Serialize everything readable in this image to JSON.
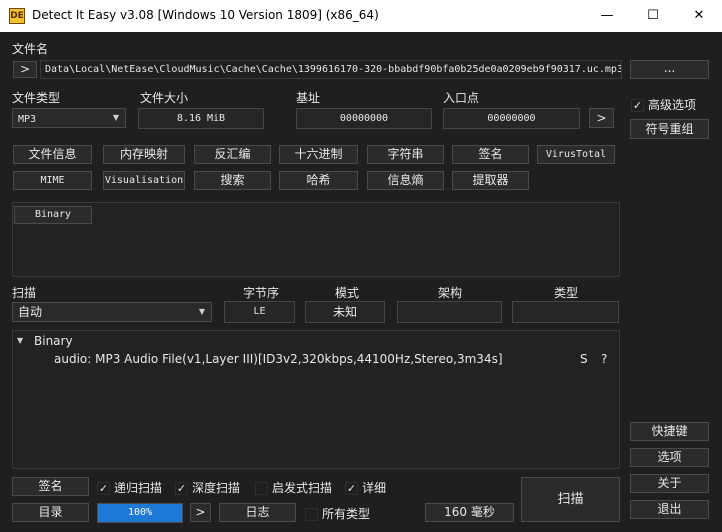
{
  "window": {
    "title": "Detect It Easy v3.08 [Windows 10 Version 1809] (x86_64)",
    "icon_text": "DE",
    "minimize": "—",
    "maximize": "☐",
    "close": "✕"
  },
  "file": {
    "label": "文件名",
    "path": "Data\\Local\\NetEase\\CloudMusic\\Cache\\Cache\\1399616170-320-bbabdf90bfa0b25de0a0209eb9f90317.uc.mp3",
    "prev_button": ">",
    "browse_button": "..."
  },
  "info": {
    "type_label": "文件类型",
    "type_value": "MP3",
    "size_label": "文件大小",
    "size_value": "8.16 MiB",
    "base_label": "基址",
    "base_value": "00000000",
    "entry_label": "入口点",
    "entry_value": "00000000",
    "entry_go": ">"
  },
  "right_panel": {
    "advanced": "高级选项",
    "advanced_checked": "✓",
    "rebuild": "符号重组",
    "shortcuts": "快捷键",
    "options": "选项",
    "about": "关于",
    "exit": "退出"
  },
  "tools": {
    "row1": [
      "文件信息",
      "内存映射",
      "反汇编",
      "十六进制",
      "字符串",
      "签名",
      "VirusTotal"
    ],
    "row2": [
      "MIME",
      "Visualisation",
      "搜索",
      "哈希",
      "信息熵",
      "提取器"
    ]
  },
  "binary_tag": "Binary",
  "scan_header": {
    "scan_label": "扫描",
    "mode_value": "自动",
    "endian_label": "字节序",
    "endian_value": "LE",
    "mode_label": "模式",
    "mode_field": "未知",
    "arch_label": "架构",
    "arch_value": "",
    "type_label": "类型",
    "type_value": ""
  },
  "result": {
    "root": "Binary",
    "expander": "▼",
    "line": "audio: MP3 Audio File(v1,Layer III)[ID3v2,320kbps,44100Hz,Stereo,3m34s]",
    "s": "S",
    "q": "?"
  },
  "bottom": {
    "signature": "签名",
    "recursive": "递归扫描",
    "deep": "深度扫描",
    "heuristic": "启发式扫描",
    "verbose": "详细",
    "check": "✓",
    "directory": "目录",
    "progress_text": "100%",
    "progress_value": 1.0,
    "next": ">",
    "log": "日志",
    "all_types": "所有类型",
    "time": "160 毫秒",
    "scan": "扫描"
  },
  "colors": {
    "background": "#1f1f1f",
    "titlebar": "#ffffff",
    "progress": "#1e78d6"
  }
}
